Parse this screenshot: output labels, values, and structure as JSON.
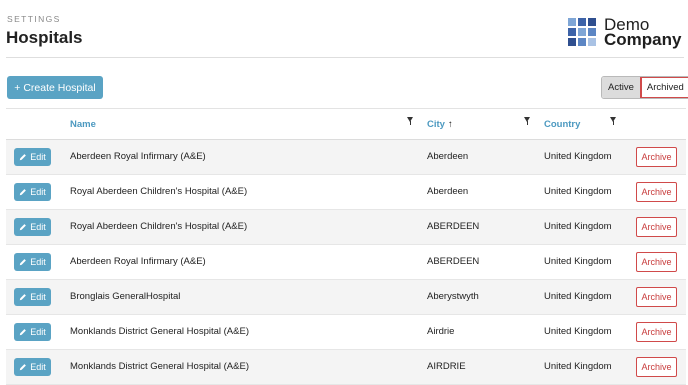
{
  "header": {
    "eyebrow": "SETTINGS",
    "title": "Hospitals",
    "logo_line1": "Demo",
    "logo_line2": "Company"
  },
  "toolbar": {
    "create_label": "+ Create Hospital",
    "toggle_active": "Active",
    "toggle_archived": "Archived"
  },
  "table": {
    "columns": {
      "name": "Name",
      "city": "City",
      "country": "Country",
      "city_sort": "↑"
    },
    "edit_label": "Edit",
    "archive_label": "Archive",
    "rows": [
      {
        "name": "Aberdeen Royal Infirmary (A&E)",
        "city": "Aberdeen",
        "country": "United Kingdom"
      },
      {
        "name": "Royal Aberdeen Children's Hospital (A&E)",
        "city": "Aberdeen",
        "country": "United Kingdom"
      },
      {
        "name": "Royal Aberdeen Children's Hospital (A&E)",
        "city": "ABERDEEN",
        "country": "United Kingdom"
      },
      {
        "name": "Aberdeen Royal Infirmary (A&E)",
        "city": "ABERDEEN",
        "country": "United Kingdom"
      },
      {
        "name": "Bronglais GeneralHospital",
        "city": "Aberystwyth",
        "country": "United Kingdom"
      },
      {
        "name": "Monklands District General Hospital (A&E)",
        "city": "Airdrie",
        "country": "United Kingdom"
      },
      {
        "name": "Monklands District General Hospital (A&E)",
        "city": "AIRDRIE",
        "country": "United Kingdom"
      }
    ]
  },
  "colors": {
    "accent": "#5aa3c4",
    "link": "#4c99c0",
    "danger": "#d04a4a",
    "logo_dark": "#2f4f8f",
    "logo_light": "#7fa6d6"
  },
  "icons": {
    "edit": "pencil-icon",
    "filter": "filter-icon",
    "sort": "sort-asc-icon"
  }
}
